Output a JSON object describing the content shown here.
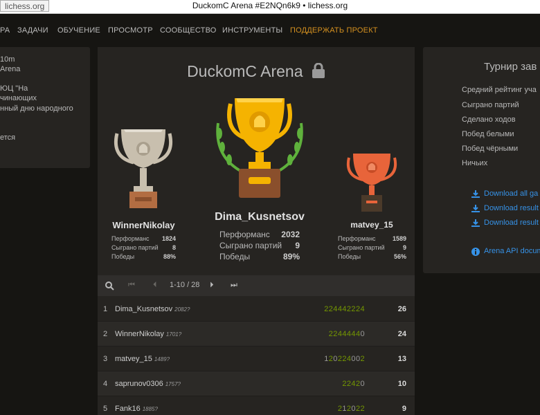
{
  "window": {
    "url_chip": "lichess.org",
    "title": "DuckomC Arena #E2NQn6k9 • lichess.org"
  },
  "nav": {
    "items": [
      "РА",
      "ЗАДАЧИ",
      "ОБУЧЕНИЕ",
      "ПРОСМОТР",
      "СООБЩЕСТВО",
      "ИНСТРУМЕНТЫ"
    ],
    "support": "ПОДДЕРЖАТЬ ПРОЕКТ"
  },
  "left_panel": {
    "lines": [
      "10m",
      "Arena",
      "",
      "ЮЦ \"На",
      "чинающих",
      "нный дню народного",
      "",
      "ется"
    ]
  },
  "tournament": {
    "title": "DuckomC Arena"
  },
  "podium": {
    "first": {
      "name": "Dima_Kusnetsov",
      "performance_label": "Перформанс",
      "performance": "2032",
      "games_label": "Сыграно партий",
      "games": "9",
      "wins_label": "Победы",
      "wins": "89%"
    },
    "second": {
      "name": "WinnerNikolay",
      "performance_label": "Перформанс",
      "performance": "1824",
      "games_label": "Сыграно партий",
      "games": "8",
      "wins_label": "Победы",
      "wins": "88%"
    },
    "third": {
      "name": "matvey_15",
      "performance_label": "Перформанс",
      "performance": "1589",
      "games_label": "Сыграно партий",
      "games": "9",
      "wins_label": "Победы",
      "wins": "56%"
    }
  },
  "pager": {
    "range": "1-10 / 28"
  },
  "standings": [
    {
      "rank": "1",
      "user": "Dima_Kusnetsov",
      "rating": "2082?",
      "sheet": "224442224",
      "score": "26"
    },
    {
      "rank": "2",
      "user": "WinnerNikolay",
      "rating": "1701?",
      "sheet": "22444440",
      "score": "24"
    },
    {
      "rank": "3",
      "user": "matvey_15",
      "rating": "1489?",
      "sheet": "120224002",
      "score": "13"
    },
    {
      "rank": "4",
      "user": "saprunov0306",
      "rating": "1757?",
      "sheet": "22420",
      "score": "10"
    },
    {
      "rank": "5",
      "user": "Fank16",
      "rating": "1885?",
      "sheet": "212022",
      "score": "9"
    }
  ],
  "right_panel": {
    "title": "Турнир зав",
    "stats": [
      "Средний рейтинг уча",
      "Сыграно партий",
      "Сделано ходов",
      "Побед белыми",
      "Побед чёрными",
      "Ничьих"
    ],
    "downloads": [
      "Download all ga",
      "Download result",
      "Download result"
    ],
    "api": "Arena API docum"
  },
  "colors": {
    "background": "#161512",
    "panel": "#262421",
    "accent": "#d59120",
    "link": "#3692e7",
    "gold": "#f5b301",
    "silver": "#c8bfae",
    "bronze": "#e8643a",
    "win_green": "#759900"
  }
}
